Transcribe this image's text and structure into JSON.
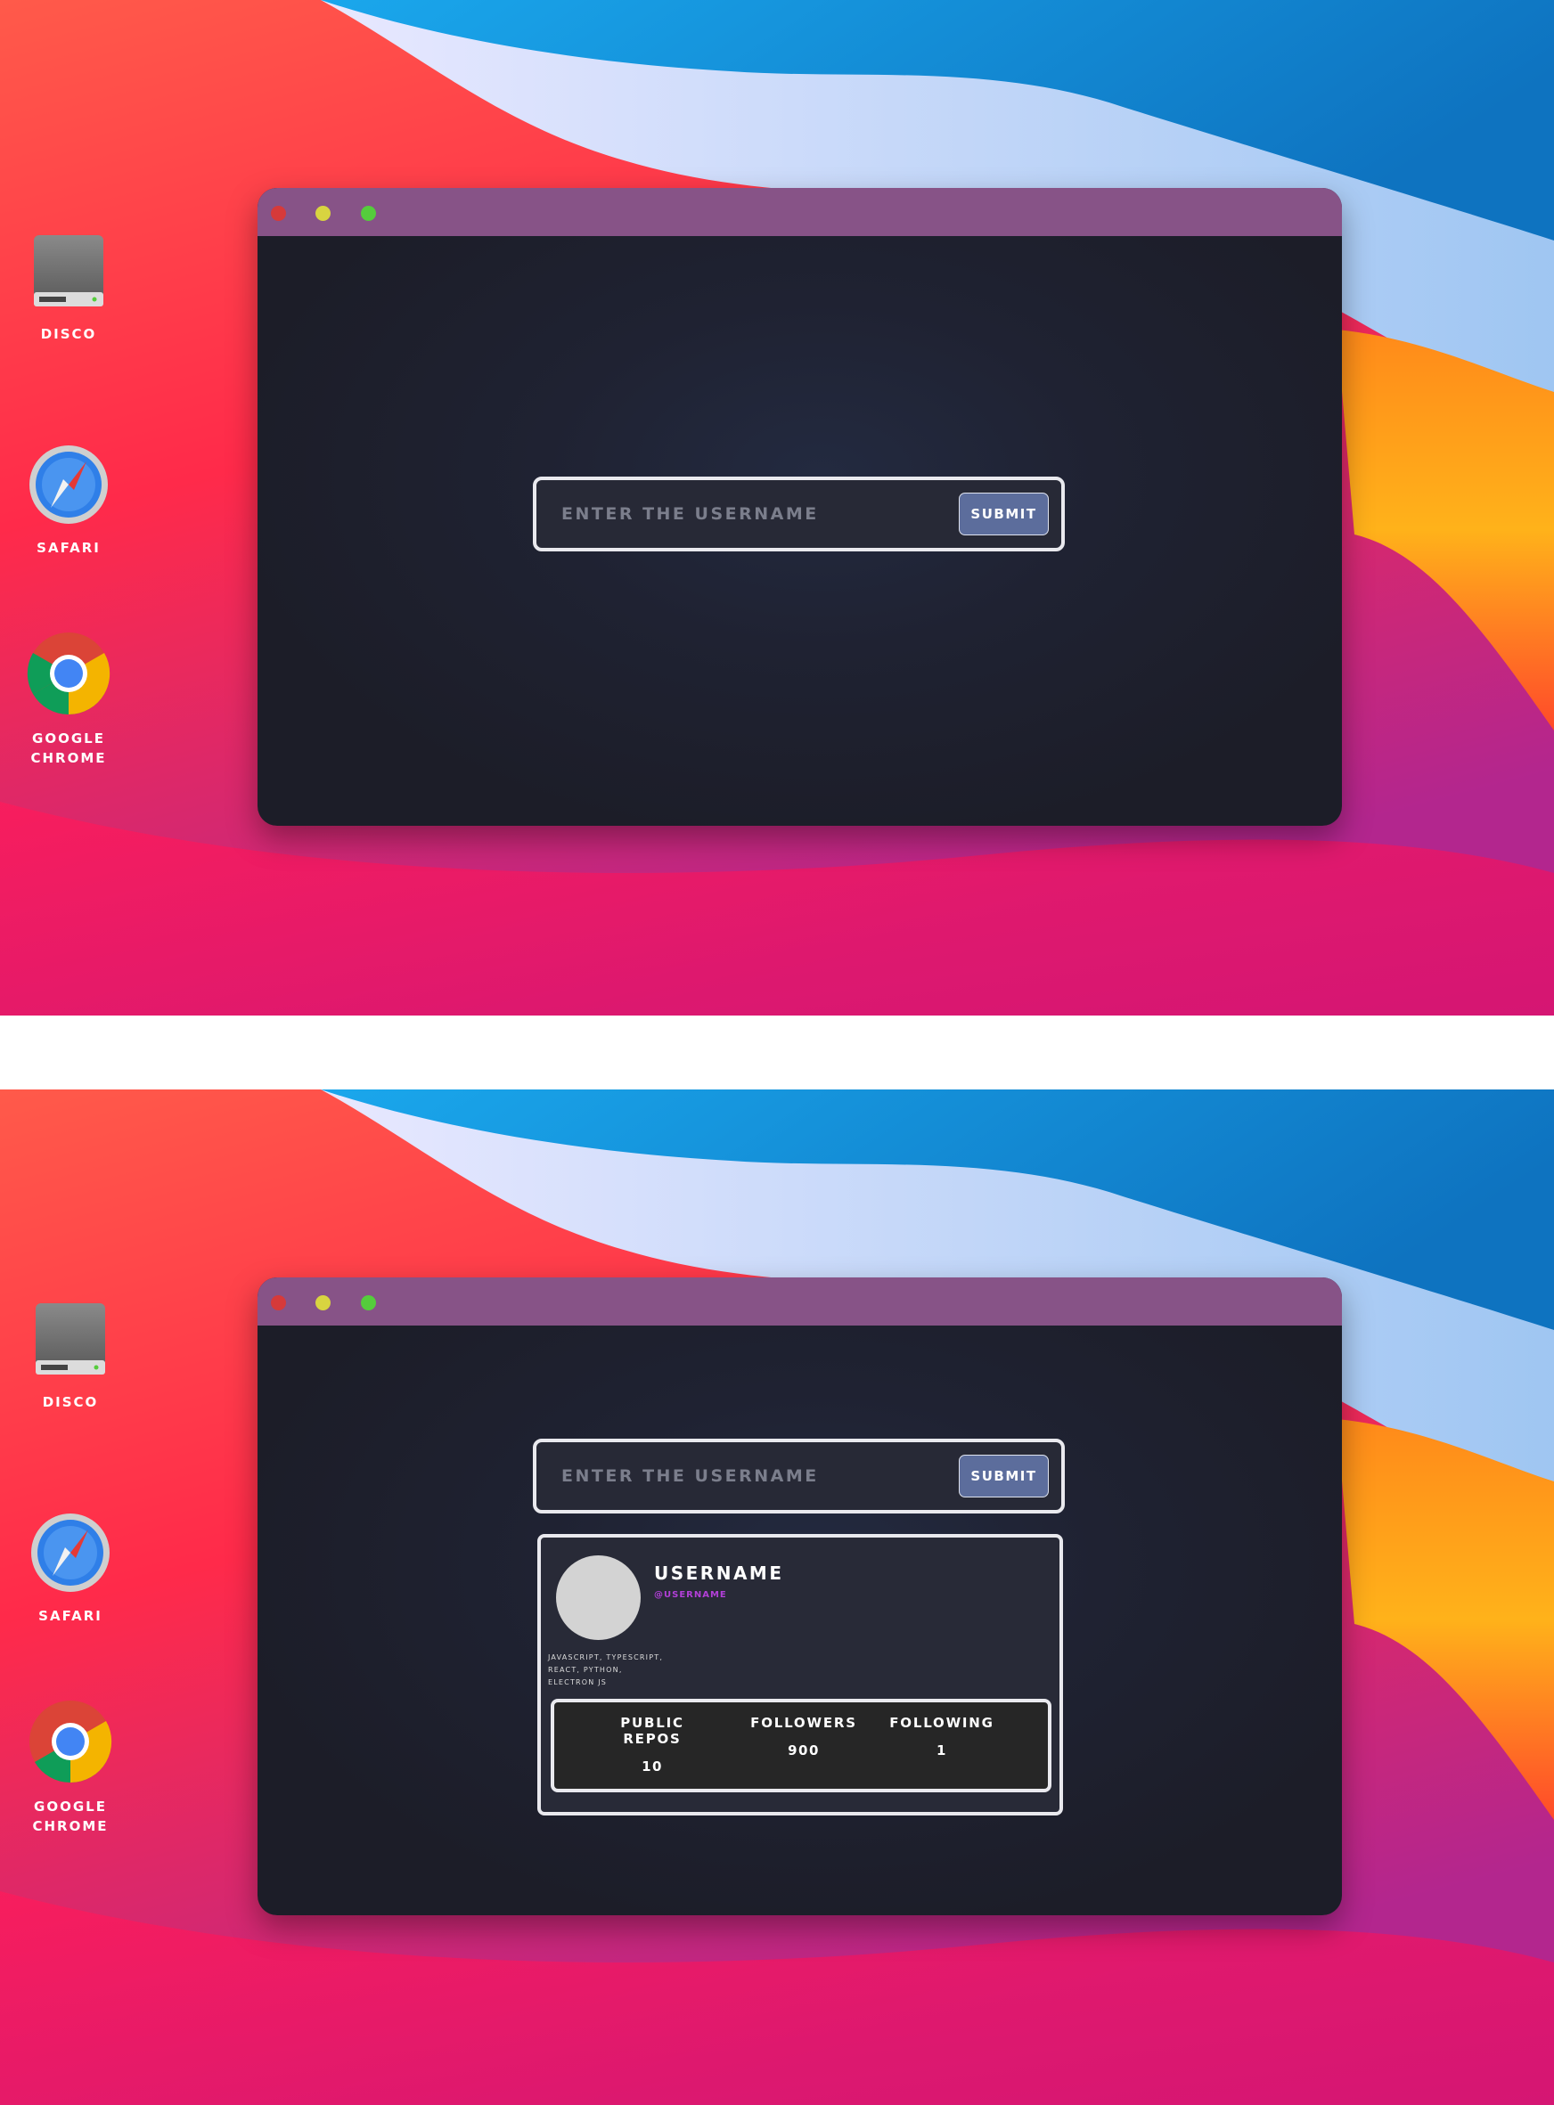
{
  "colors": {
    "titlebar": "#875387",
    "window_bg": "#1c1d28",
    "accent_button": "#5c6d9c",
    "handle": "#b23fd8"
  },
  "desktop_icons": [
    {
      "label": "DISCO",
      "icon": "hard-disk-icon"
    },
    {
      "label": "SAFARI",
      "icon": "safari-icon"
    },
    {
      "label": "GOOGLE\nCHROME",
      "icon": "chrome-icon"
    }
  ],
  "window": {
    "controls": [
      "close",
      "minimize",
      "maximize"
    ]
  },
  "search": {
    "placeholder": "ENTER THE USERNAME",
    "submit_label": "SUBMIT"
  },
  "profile": {
    "name": "USERNAME",
    "handle": "@USERNAME",
    "bio": "JAVASCRIPT, TYPESCRIPT, REACT, PYTHON, ELECTRON JS",
    "stats": {
      "repos_label": "PUBLIC REPOS",
      "repos_value": "10",
      "followers_label": "FOLLOWERS",
      "followers_value": "900",
      "following_label": "FOLLOWING",
      "following_value": "1"
    }
  }
}
